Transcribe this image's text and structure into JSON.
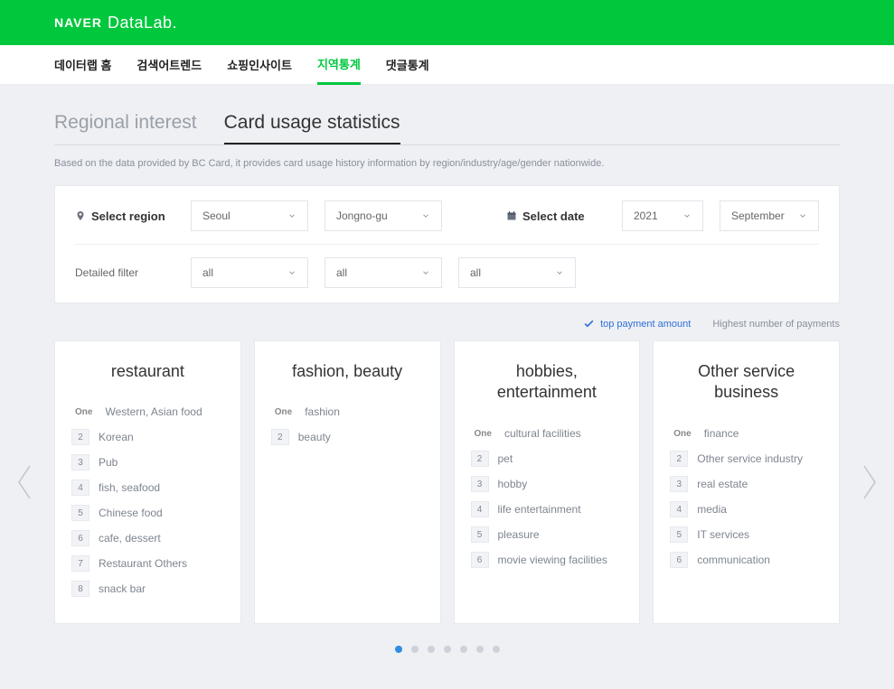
{
  "brand": {
    "name": "NAVER",
    "product": "DataLab."
  },
  "nav": {
    "items": [
      "데이터랩 홈",
      "검색어트렌드",
      "쇼핑인사이트",
      "지역통계",
      "댓글통계"
    ],
    "active_index": 3
  },
  "subtabs": {
    "items": [
      "Regional interest",
      "Card usage statistics"
    ],
    "active_index": 1
  },
  "description": "Based on the data provided by BC Card, it provides card usage history information by region/industry/age/gender nationwide.",
  "region": {
    "label": "Select region",
    "city": "Seoul",
    "district": "Jongno-gu"
  },
  "date": {
    "label": "Select date",
    "year": "2021",
    "month": "September"
  },
  "detail": {
    "label": "Detailed filter",
    "v1": "all",
    "v2": "all",
    "v3": "all"
  },
  "sort": {
    "opt1": "top payment amount",
    "opt2": "Highest number of payments",
    "active": 0
  },
  "cards": [
    {
      "title": "restaurant",
      "items": [
        "Western, Asian food",
        "Korean",
        "Pub",
        "fish, seafood",
        "Chinese food",
        "cafe, dessert",
        "Restaurant Others",
        "snack bar"
      ]
    },
    {
      "title": "fashion, beauty",
      "items": [
        "fashion",
        "beauty"
      ]
    },
    {
      "title": "hobbies, entertainment",
      "items": [
        "cultural facilities",
        "pet",
        "hobby",
        "life entertainment",
        "pleasure",
        "movie viewing facilities"
      ]
    },
    {
      "title": "Other service business",
      "items": [
        "finance",
        "Other service industry",
        "real estate",
        "media",
        "IT services",
        "communication"
      ]
    }
  ],
  "ranks": {
    "one": "One"
  },
  "pagination": {
    "total": 7,
    "active": 0
  }
}
